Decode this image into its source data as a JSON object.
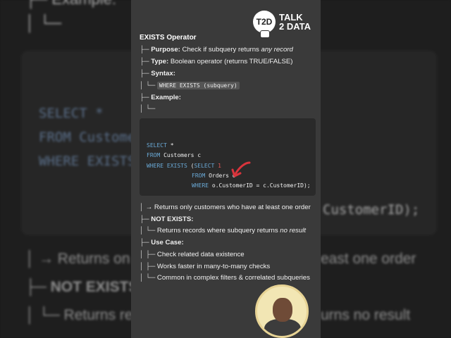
{
  "logo": {
    "badge": "T2D",
    "line1": "TALK",
    "line2": "2 DATA"
  },
  "tree": {
    "title": "EXISTS Operator",
    "purpose_label": "Purpose:",
    "purpose_text": "Check if subquery returns",
    "purpose_emph": "any record",
    "type_label": "Type:",
    "type_text": "Boolean operator (returns TRUE/FALSE)",
    "syntax_label": "Syntax:",
    "syntax_code": "WHERE EXISTS (subquery)",
    "example_label": "Example:",
    "returns_text": "→ Returns only customers who have at least one order",
    "not_exists_label": "NOT EXISTS:",
    "not_exists_text": "Returns records where subquery returns",
    "not_exists_emph": "no result",
    "use_case_label": "Use Case:",
    "use_cases": [
      "Check related data existence",
      "Works faster in many-to-many checks",
      "Common in complex filters & correlated subqueries"
    ]
  },
  "code": {
    "l1_kw": "SELECT",
    "l1_rest": " *",
    "l2_kw": "FROM",
    "l2_rest": " Customers c",
    "l3_kw": "WHERE EXISTS",
    "l3_mid": " (",
    "l3_kw2": "SELECT",
    "l3_num": " 1",
    "l4_kw": "FROM",
    "l4_rest": " Orders o",
    "l5_kw": "WHERE",
    "l5_rest": " o.CustomerID = c.CustomerID);"
  },
  "background": {
    "top1": "├─ Example:",
    "top2": "│ └─",
    "code1": "SELECT *",
    "code2": "FROM Customer",
    "code3": "WHERE EXISTS",
    "code_right": "CustomerID);",
    "line1_left": "│ → Returns on",
    "line1_right": "east one order",
    "line2": "├─ NOT EXISTS",
    "line3_left": "│ └─ Returns re",
    "line3_right": "urns no result"
  },
  "colors": {
    "accent_red": "#d9343c",
    "keyword_blue": "#6aa9d6",
    "panel_bg": "#3a3a3a"
  }
}
